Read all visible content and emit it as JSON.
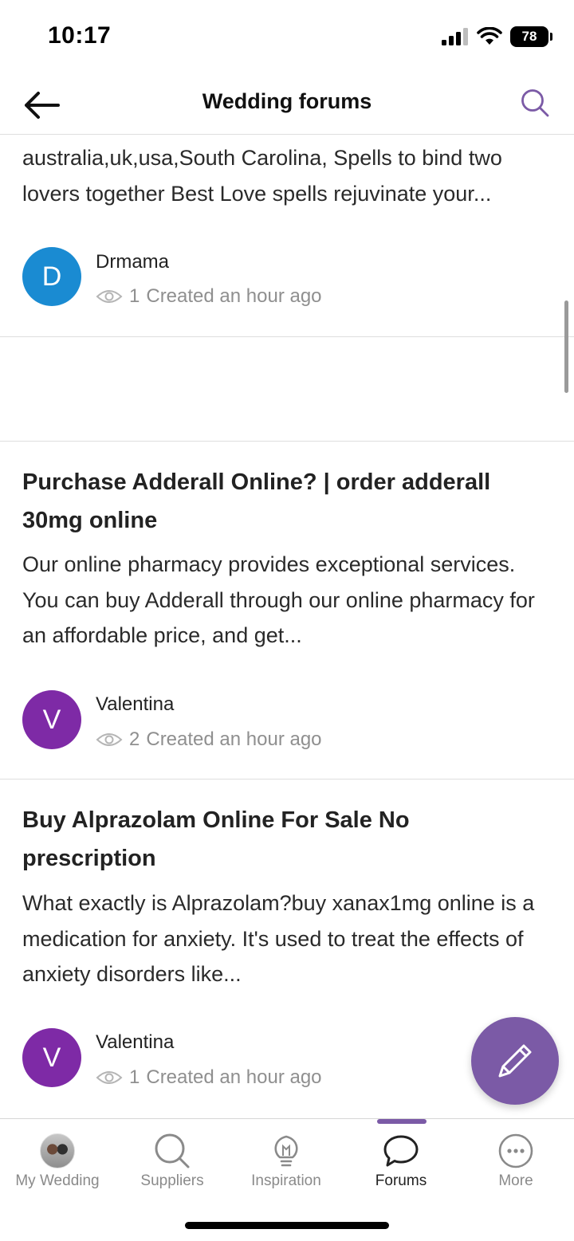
{
  "status_bar": {
    "time": "10:17",
    "battery": "78"
  },
  "header": {
    "title": "Wedding forums"
  },
  "posts": [
    {
      "excerpt": "australia,uk,usa,South Carolina, Spells to bind two lovers together Best Love spells rejuvinate your...",
      "author": "Drmama",
      "avatar_letter": "D",
      "avatar_color": "#1a8bd2",
      "views": "1",
      "created": "Created an hour ago"
    },
    {
      "title": "Purchase Adderall Online? | order adderall 30mg online",
      "excerpt": "Our online pharmacy provides exceptional services. You can buy Adderall through our online pharmacy for an affordable price, and get...",
      "author": "Valentina",
      "avatar_letter": "V",
      "avatar_color": "#7e2aa6",
      "views": "2",
      "created": "Created an hour ago"
    },
    {
      "title": "Buy Alprazolam Online For Sale No prescription",
      "excerpt": "What exactly is Alprazolam?buy xanax1mg online is a medication for anxiety. It's used to treat the effects of anxiety disorders like...",
      "author": "Valentina",
      "avatar_letter": "V",
      "avatar_color": "#7e2aa6",
      "views": "1",
      "created": "Created an hour ago"
    }
  ],
  "tabs": [
    {
      "label": "My Wedding",
      "icon": "avatar-photo-icon"
    },
    {
      "label": "Suppliers",
      "icon": "search-icon"
    },
    {
      "label": "Inspiration",
      "icon": "lightbulb-icon"
    },
    {
      "label": "Forums",
      "icon": "speech-bubble-icon",
      "active": true
    },
    {
      "label": "More",
      "icon": "more-dots-icon"
    }
  ],
  "colors": {
    "accent": "#7b5aa6",
    "muted_text": "#8f8f8f",
    "divider": "#dedede"
  }
}
